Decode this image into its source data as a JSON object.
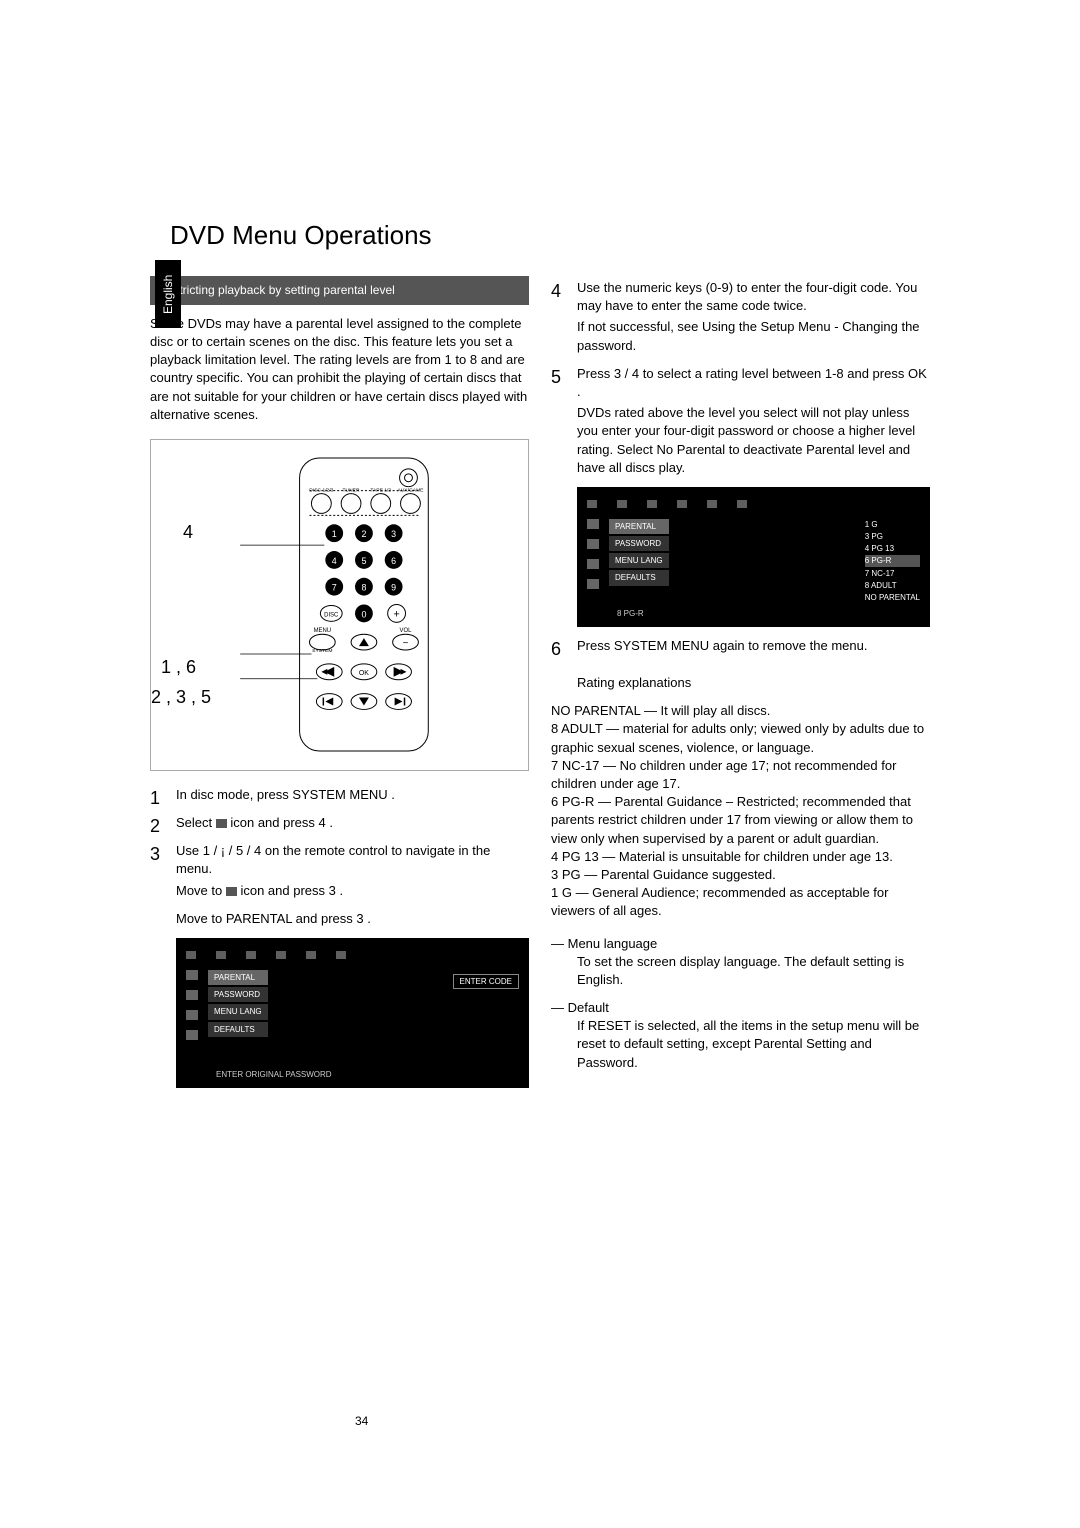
{
  "language_tab": "English",
  "title": "DVD Menu Operations",
  "page_number": "34",
  "left": {
    "section_heading": "Restricting playback by setting parental level",
    "intro": "Some DVDs may have a parental level assigned to the complete disc or to certain scenes on the disc. This feature lets you set a playback limitation level. The rating levels are from 1 to 8 and are country specific. You can prohibit the playing of certain discs that are not suitable for your children or have certain discs played with alternative scenes.",
    "callouts": {
      "a": "4",
      "b": "1 , 6",
      "c": "2 , 3 , 5"
    },
    "remote_labels": {
      "disc123": "DISC 1/2/3",
      "tuner": "TUNER",
      "tape": "TAPE 1/2",
      "aux": "AUX/GAME",
      "disc": "DISC",
      "menu": "MENU",
      "system": "SYSTEM",
      "vol": "VOL",
      "ok": "OK"
    },
    "step1": "In disc mode, press SYSTEM MENU .",
    "step2_a": "Select ",
    "step2_b": " icon and press 4 .",
    "step3": "Use 1  / ¡  / 5  / 4  on the remote control to navigate in the menu.",
    "step3_sub1_a": "Move to ",
    "step3_sub1_b": " icon and press 3 .",
    "step3_sub2": "Move to  PARENTAL  and press 3 .",
    "osd1": {
      "items": [
        "PARENTAL",
        "PASSWORD",
        "MENU LANG",
        "DEFAULTS"
      ],
      "right": "ENTER CODE",
      "foot": "ENTER ORIGINAL PASSWORD"
    }
  },
  "right": {
    "step4": "Use the numeric keys (0-9)  to enter the four-digit code. You may have to enter the same code twice.",
    "step4_sub": "If not successful, see Using the Setup Menu - Changing the password.",
    "step5": "Press 3  / 4  to select a rating level between 1-8 and press OK .",
    "step5_sub": "DVDs rated above the level you select will not play unless you enter your four-digit password or choose a higher level rating. Select  No Parental  to deactivate Parental level and have all discs play.",
    "osd2": {
      "items": [
        "PARENTAL",
        "PASSWORD",
        "MENU LANG",
        "DEFAULTS"
      ],
      "options": [
        "1 G",
        "3 PG",
        "4 PG 13",
        "6 PG-R",
        "7 NC-17",
        "8 ADULT",
        "NO PARENTAL"
      ],
      "foot": "8 PG-R"
    },
    "step6": "Press SYSTEM MENU  again to remove the menu.",
    "ratings_heading": "Rating explanations",
    "r_no_parental": "NO PARENTAL  — It will play all discs.",
    "r_8": "8 ADULT  — material for adults only; viewed only by adults due to graphic sexual scenes, violence, or language.",
    "r_7": "7 NC-17 — No children under age 17; not recommended for children under age 17.",
    "r_6": "6 PG-R — Parental Guidance – Restricted; recommended that parents restrict children under 17 from viewing or allow them to view only when supervised by a parent or adult guardian.",
    "r_4": "4 PG 13 — Material is unsuitable for children under age 13.",
    "r_3": "3 PG — Parental Guidance suggested.",
    "r_1": "1 G — General Audience; recommended as acceptable for viewers of all ages.",
    "menu_lang_h": "— Menu language",
    "menu_lang_t": "To set the screen display language. The default setting is English.",
    "default_h": "— Default",
    "default_t": "If RESET is selected, all the items in the setup menu will be reset to default setting, except Parental Setting and Password."
  }
}
